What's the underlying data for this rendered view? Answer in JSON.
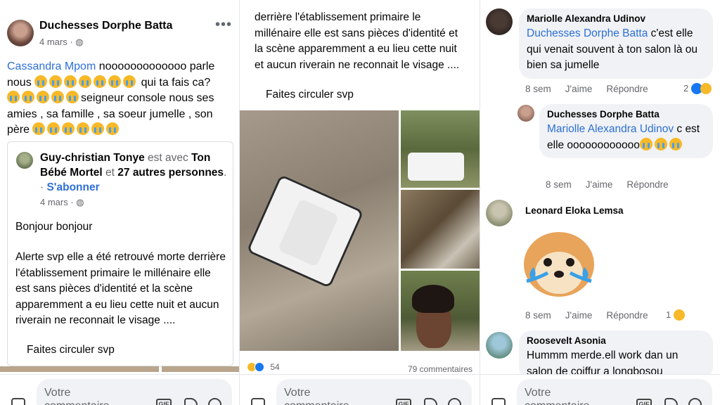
{
  "panel1": {
    "author": "Duchesses Dorphe Batta",
    "date": "4 mars · ",
    "more": "•••",
    "mention": "Cassandra Mpom",
    "text_a": " nooooooooooooo parle nous ",
    "text_b": " qui ta fais ca?",
    "text_c": "seigneur console nous  ses amies , sa famille , sa soeur jumelle , son père ",
    "shared": {
      "author": "Guy-christian Tonye",
      "with": " est avec ",
      "tag1": "Ton Bébé Mortel",
      "and": " et ",
      "others": "27 autres personnes",
      "dot": ". · ",
      "follow": "S'abonner",
      "date": "4 mars · ",
      "greeting": "Bonjour bonjour",
      "body": "Alerte svp elle a été retrouvé morte derrière l'établissement primaire le millénaire elle est sans pièces d'identité et la scène apparemment a eu lieu cette nuit et aucun riverain ne reconnait le visage ....",
      "footer": "Faites circuler svp"
    }
  },
  "panel2": {
    "text": "derrière l'établissement primaire le millénaire elle est sans pièces d'identité et la scène apparemment a eu lieu cette nuit et aucun riverain ne reconnait le visage ....",
    "footer": "Faites circuler svp",
    "reaction_count": "54",
    "comment_count": "79 commentaires"
  },
  "panel3": {
    "comments": [
      {
        "author": "Mariolle Alexandra Udinov",
        "mention": "Duchesses Dorphe Batta",
        "text": " c'est elle qui venait souvent à ton salon là ou bien sa jumelle",
        "time": "8 sem",
        "like": "J'aime",
        "reply": "Répondre",
        "reactions": "2"
      },
      {
        "author": "Duchesses Dorphe Batta",
        "mention": "Mariolle Alexandra Udinov",
        "text": " c est elle oooooooooooo",
        "time": "8 sem",
        "like": "J'aime",
        "reply": "Répondre"
      },
      {
        "author": "Leonard Eloka Lemsa",
        "time": "8 sem",
        "like": "J'aime",
        "reply": "Répondre",
        "reactions": "1"
      },
      {
        "author": "Roosevelt Asonia",
        "text": "Hummm merde.ell  work dan un salon de coiffur a longbosou"
      }
    ]
  },
  "composer": {
    "placeholder": "Votre commentaire",
    "gif": "GIF"
  },
  "colors": {
    "link": "#2d6fd4",
    "bubble": "#f0f2f5",
    "muted": "#65676b"
  }
}
